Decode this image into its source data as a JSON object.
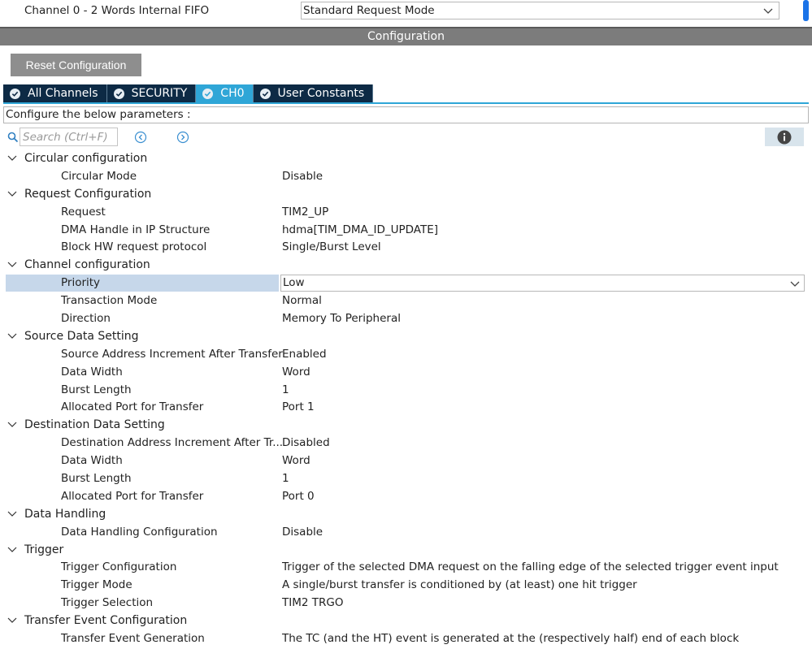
{
  "top": {
    "channel_label": "Channel 0  - 2 Words Internal FIFO",
    "request_mode": "Standard Request Mode"
  },
  "config_header": "Configuration",
  "reset_label": "Reset Configuration",
  "tabs": [
    {
      "label": "All Channels"
    },
    {
      "label": "SECURITY"
    },
    {
      "label": "CH0"
    },
    {
      "label": "User Constants"
    }
  ],
  "description": "Configure the below parameters :",
  "search": {
    "placeholder": "Search (Ctrl+F)"
  },
  "groups": [
    {
      "title": "Circular configuration",
      "params": [
        {
          "name": "Circular Mode",
          "value": "Disable"
        }
      ]
    },
    {
      "title": "Request Configuration",
      "params": [
        {
          "name": "Request",
          "value": "TIM2_UP"
        },
        {
          "name": "DMA Handle in IP Structure",
          "value": "hdma[TIM_DMA_ID_UPDATE]"
        },
        {
          "name": "Block HW request protocol",
          "value": "Single/Burst Level"
        }
      ]
    },
    {
      "title": "Channel configuration",
      "params": [
        {
          "name": "Priority",
          "value": "Low"
        },
        {
          "name": "Transaction Mode",
          "value": "Normal"
        },
        {
          "name": "Direction",
          "value": "Memory To Peripheral"
        }
      ]
    },
    {
      "title": "Source Data Setting",
      "params": [
        {
          "name": "Source Address Increment After Transfer",
          "value": "Enabled"
        },
        {
          "name": "Data Width",
          "value": "Word"
        },
        {
          "name": "Burst Length",
          "value": "1"
        },
        {
          "name": "Allocated Port for Transfer",
          "value": "Port 1"
        }
      ]
    },
    {
      "title": "Destination Data Setting",
      "params": [
        {
          "name": "Destination Address Increment After Tr...",
          "value": "Disabled"
        },
        {
          "name": "Data Width",
          "value": "Word"
        },
        {
          "name": "Burst Length",
          "value": "1"
        },
        {
          "name": "Allocated Port for Transfer",
          "value": "Port 0"
        }
      ]
    },
    {
      "title": "Data Handling",
      "params": [
        {
          "name": "Data Handling Configuration",
          "value": "Disable"
        }
      ]
    },
    {
      "title": "Trigger",
      "params": [
        {
          "name": "Trigger Configuration",
          "value": "Trigger of the selected DMA request on the falling edge of the selected trigger event input"
        },
        {
          "name": "Trigger Mode",
          "value": "A single/burst transfer is conditioned by (at least) one hit trigger"
        },
        {
          "name": "Trigger Selection",
          "value": "TIM2 TRGO"
        }
      ]
    },
    {
      "title": "Transfer Event Configuration",
      "params": [
        {
          "name": "Transfer Event Generation",
          "value": "The TC (and the HT) event is generated at the (respectively half) end of each block"
        }
      ]
    }
  ]
}
